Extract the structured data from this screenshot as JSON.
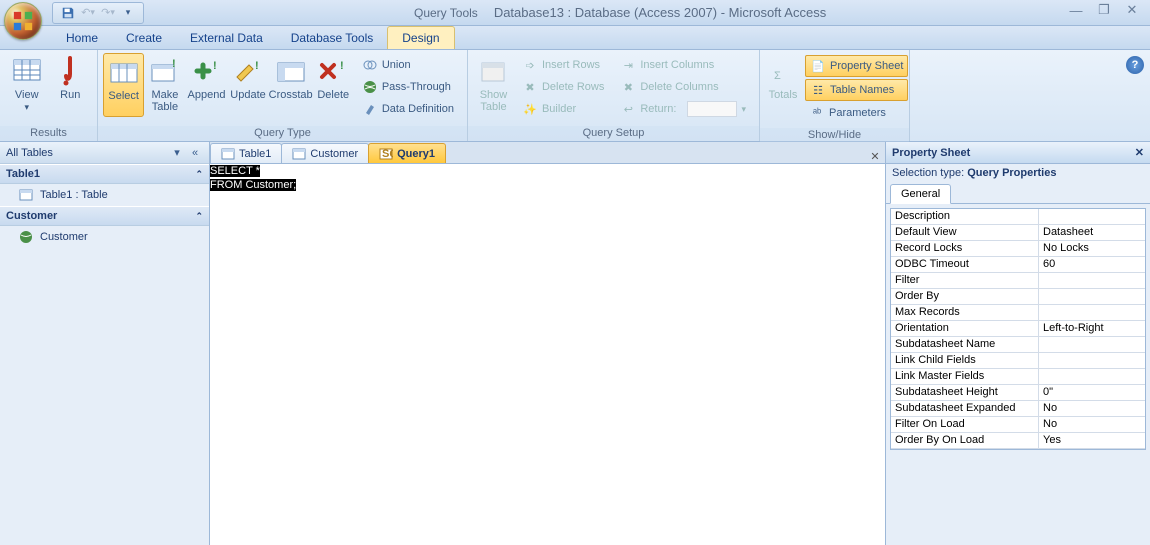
{
  "title": {
    "context_label": "Query Tools",
    "text": "Database13 : Database (Access 2007) - Microsoft Access"
  },
  "menu_tabs": [
    "Home",
    "Create",
    "External Data",
    "Database Tools",
    "Design"
  ],
  "ribbon": {
    "results": {
      "label": "Results",
      "view": "View",
      "run": "Run"
    },
    "query_type": {
      "label": "Query Type",
      "select": "Select",
      "make_table": "Make Table",
      "append": "Append",
      "update": "Update",
      "crosstab": "Crosstab",
      "delete": "Delete",
      "union": "Union",
      "pass_through": "Pass-Through",
      "data_definition": "Data Definition"
    },
    "query_setup": {
      "label": "Query Setup",
      "show_table": "Show Table",
      "insert_rows": "Insert Rows",
      "delete_rows": "Delete Rows",
      "builder": "Builder",
      "insert_columns": "Insert Columns",
      "delete_columns": "Delete Columns",
      "return": "Return:"
    },
    "showhide": {
      "label": "Show/Hide",
      "totals": "Totals",
      "property_sheet": "Property Sheet",
      "table_names": "Table Names",
      "parameters": "Parameters"
    }
  },
  "nav": {
    "title": "All Tables",
    "groups": [
      {
        "name": "Table1",
        "items": [
          {
            "label": "Table1 : Table",
            "icon": "table"
          }
        ]
      },
      {
        "name": "Customer",
        "items": [
          {
            "label": "Customer",
            "icon": "query-globe"
          }
        ]
      }
    ]
  },
  "doc": {
    "tabs": [
      {
        "label": "Table1",
        "icon": "table"
      },
      {
        "label": "Customer",
        "icon": "table"
      },
      {
        "label": "Query1",
        "icon": "sql",
        "active": true
      }
    ],
    "sql_lines": [
      "SELECT *",
      "FROM Customer;"
    ]
  },
  "prop": {
    "title": "Property Sheet",
    "selection_prefix": "Selection type: ",
    "selection_type": "Query Properties",
    "tab": "General",
    "rows": [
      {
        "name": "Description",
        "value": ""
      },
      {
        "name": "Default View",
        "value": "Datasheet"
      },
      {
        "name": "Record Locks",
        "value": "No Locks"
      },
      {
        "name": "ODBC Timeout",
        "value": "60"
      },
      {
        "name": "Filter",
        "value": ""
      },
      {
        "name": "Order By",
        "value": ""
      },
      {
        "name": "Max Records",
        "value": ""
      },
      {
        "name": "Orientation",
        "value": "Left-to-Right"
      },
      {
        "name": "Subdatasheet Name",
        "value": ""
      },
      {
        "name": "Link Child Fields",
        "value": ""
      },
      {
        "name": "Link Master Fields",
        "value": ""
      },
      {
        "name": "Subdatasheet Height",
        "value": "0\""
      },
      {
        "name": "Subdatasheet Expanded",
        "value": "No"
      },
      {
        "name": "Filter On Load",
        "value": "No"
      },
      {
        "name": "Order By On Load",
        "value": "Yes"
      }
    ]
  }
}
